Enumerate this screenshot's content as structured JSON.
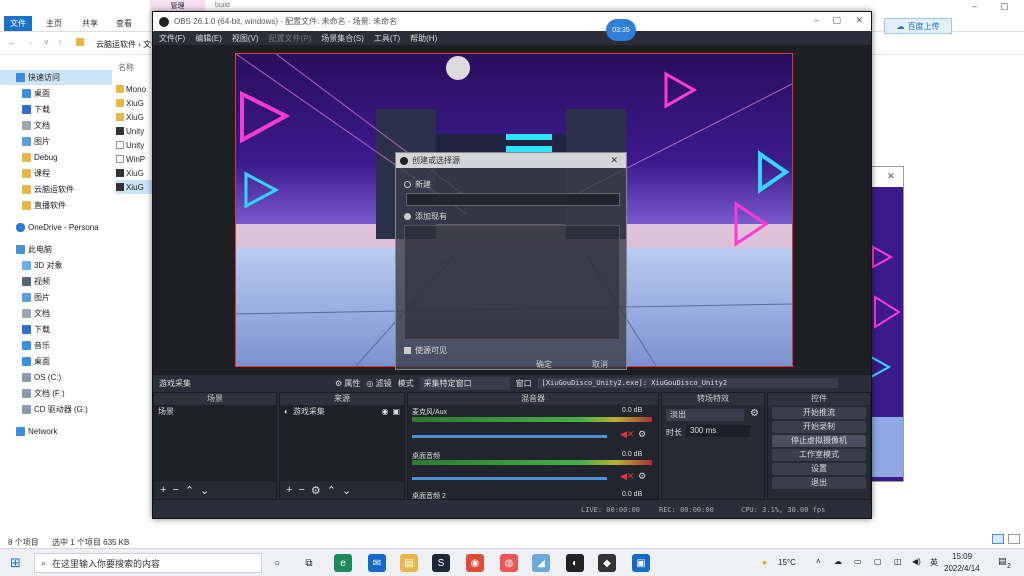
{
  "explorer": {
    "ribbon_tabs": [
      "文件",
      "主页",
      "共享",
      "查看"
    ],
    "context_tabs": [
      "管理",
      "build"
    ],
    "address": "云脑运软件 › 文件...",
    "column_header": "名称",
    "nav": {
      "quick_access": "快速访问",
      "items_pinned": [
        "桌面",
        "下载",
        "文档",
        "图片"
      ],
      "items_folders": [
        "Debug",
        "课程",
        "云脑运软件",
        "直播软件"
      ],
      "onedrive": "OneDrive - Persona",
      "this_pc": "此电脑",
      "pc_items": [
        "3D 对象",
        "视频",
        "图片",
        "文档",
        "下载",
        "音乐",
        "桌面",
        "OS (C:)",
        "文档 (F:)",
        "CD 驱动器 (G:)"
      ],
      "network": "Network"
    },
    "files": [
      "Mono",
      "XiuG",
      "XiuG",
      "Unity",
      "Unity",
      "WinP",
      "XiuG",
      "XiuG"
    ],
    "status": {
      "count": "8 个项目",
      "selected": "选中 1 个项目 635 KB"
    },
    "upload_button": "百度上传"
  },
  "obs": {
    "title": "OBS 26.1.0 (64-bit, windows) - 配置文件: 未命名 - 场景: 未命名",
    "timer": "03:35",
    "menu": [
      "文件(F)",
      "编辑(E)",
      "视图(V)",
      "配置文件(P)",
      "场景集合(S)",
      "工具(T)",
      "帮助(H)"
    ],
    "source_bar": {
      "source_name": "游戏采集",
      "properties": "属性",
      "filters": "滤镜",
      "mode_label": "模式",
      "mode_value": "采集特定窗口",
      "window_label": "窗口",
      "window_value": "[XiuGouDisco_Unity2.exe]: XiuGouDisco_Unity2"
    },
    "docks": {
      "scenes": {
        "title": "场景",
        "items": [
          "场景"
        ]
      },
      "sources": {
        "title": "来源",
        "items": [
          "游戏采集"
        ]
      },
      "mixer": {
        "title": "混音器",
        "channels": [
          {
            "name": "麦克风/Aux",
            "db": "0.0 dB"
          },
          {
            "name": "桌面音频",
            "db": "0.0 dB"
          },
          {
            "name": "桌面音频 2",
            "db": "0.0 dB"
          }
        ]
      },
      "transitions": {
        "title": "转场特效",
        "type": "淡出",
        "duration_label": "时长",
        "duration_value": "300 ms"
      },
      "controls": {
        "title": "控件",
        "buttons": [
          "开始推流",
          "开始录制",
          "停止虚拟摄像机",
          "工作室模式",
          "设置",
          "退出"
        ]
      }
    },
    "status": {
      "live": "LIVE: 00:00:00",
      "rec": "REC: 00:00:00",
      "cpu": "CPU: 3.1%, 30.00 fps"
    },
    "dialog": {
      "title": "创建或选择源",
      "new_option": "新建",
      "existing_option": "添加现有",
      "visible_checkbox": "使源可见",
      "ok": "确定",
      "cancel": "取消"
    }
  },
  "taskbar": {
    "search_placeholder": "在这里输入你要搜索的内容",
    "weather": "15°C",
    "ime": "英",
    "time": "15:09",
    "date": "2022/4/14",
    "notifications": "2"
  },
  "colors": {
    "accent": "#1a73c8",
    "obs_bg": "#2b2e38",
    "rec_border": "#e33333",
    "timer": "#2f7fd8"
  }
}
